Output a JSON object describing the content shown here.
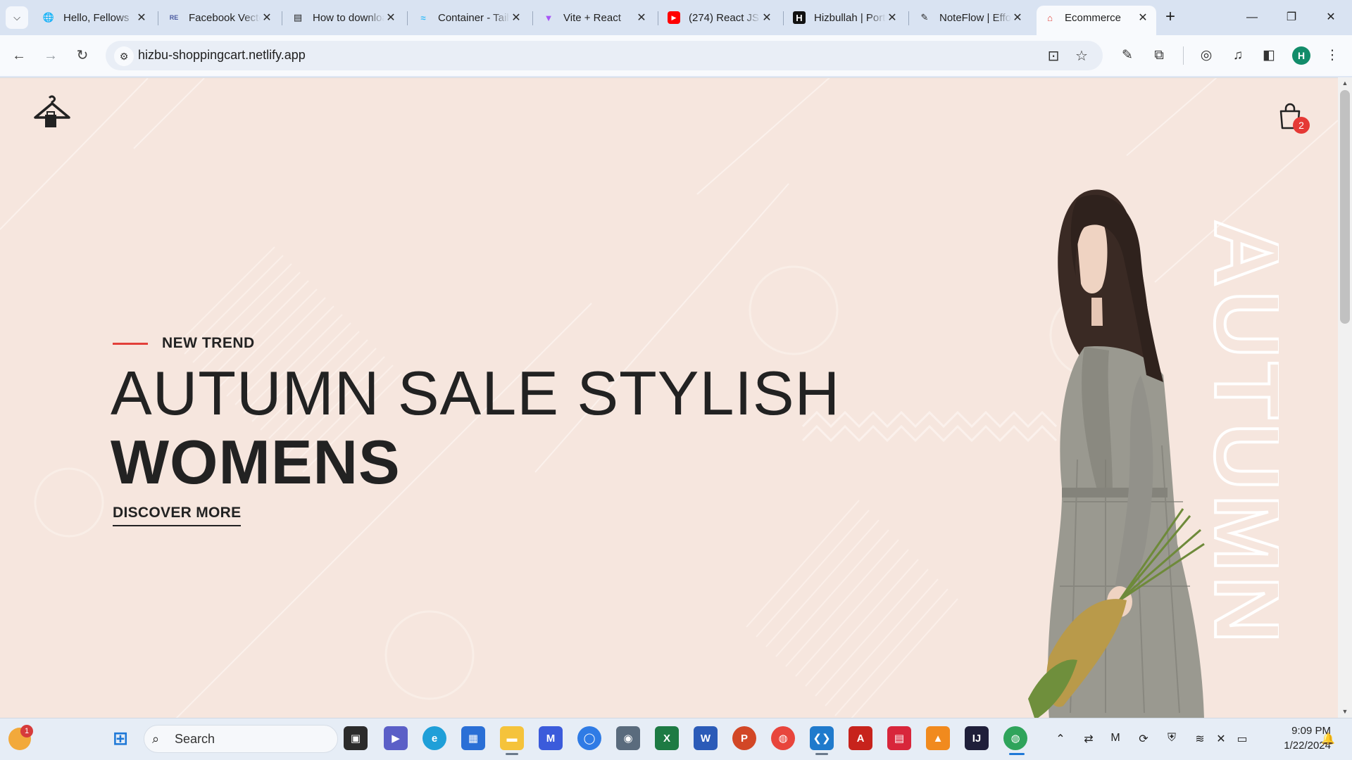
{
  "browser": {
    "tabs": [
      {
        "title": "Hello, Fellows",
        "icon": "globe-icon"
      },
      {
        "title": "Facebook Vector",
        "icon": "repo-icon"
      },
      {
        "title": "How to download",
        "icon": "page-icon"
      },
      {
        "title": "Container - Tailwind",
        "icon": "tailwind-icon"
      },
      {
        "title": "Vite + React",
        "icon": "vite-icon"
      },
      {
        "title": "(274) React JS",
        "icon": "youtube-icon"
      },
      {
        "title": "Hizbullah | Portfolio",
        "icon": "h-logo-icon"
      },
      {
        "title": "NoteFlow | Effortless",
        "icon": "note-icon"
      },
      {
        "title": "Ecommerce",
        "icon": "hanger-icon",
        "active": true
      }
    ],
    "new_tab": "+",
    "url": "hizbu-shoppingcart.netlify.app",
    "profile_initial": "H"
  },
  "page": {
    "cart_count": "2",
    "eyebrow": "NEW TREND",
    "headline_line1": "AUTUMN SALE STYLISH",
    "headline_line2": "WOMENS",
    "cta": "DISCOVER MORE",
    "vertical_word": "AUTUMN",
    "colors": {
      "background": "#f6e6de",
      "accent": "#e2403a",
      "text": "#222222"
    }
  },
  "taskbar": {
    "notification_count": "1",
    "search_placeholder": "Search",
    "time": "9:09 PM",
    "date": "1/22/2024"
  }
}
